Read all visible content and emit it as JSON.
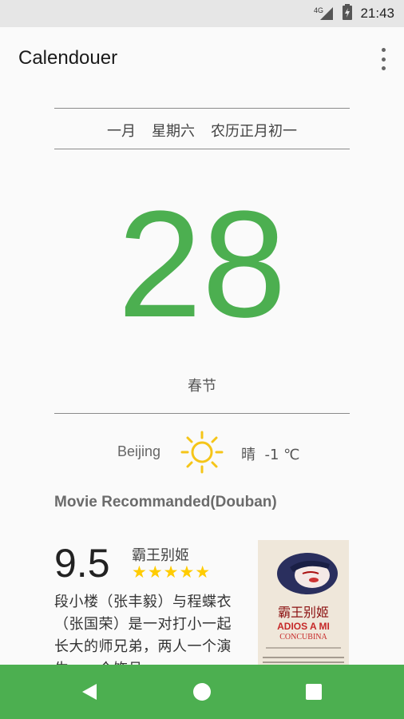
{
  "status": {
    "network": "4G",
    "time": "21:43"
  },
  "app": {
    "title": "Calendouer"
  },
  "date": {
    "month": "一月",
    "weekday": "星期六",
    "lunar": "农历正月初一",
    "day": "28",
    "festival": "春节"
  },
  "weather": {
    "city": "Beijing",
    "icon": "sun-icon",
    "description": "晴  -1 ℃"
  },
  "movie": {
    "section_title": "Movie Recommanded(Douban)",
    "score": "9.5",
    "title": "霸王别姬",
    "stars": "★★★★★",
    "rating_stars": 5,
    "synopsis": "段小楼（张丰毅）与程蝶衣（张国荣）是一对打小一起长大的师兄弟，两人一个演生，一个饰旦，一",
    "poster": {
      "title_cn": "霸王别姬",
      "title_line1": "ADIOS A MI",
      "title_line2": "CONCUBINA"
    }
  },
  "colors": {
    "accent": "#4caf50",
    "star": "#ffcc00",
    "sun": "#f5c518"
  },
  "navigation": {
    "back": "back-icon",
    "home": "home-icon",
    "recents": "recents-icon"
  }
}
